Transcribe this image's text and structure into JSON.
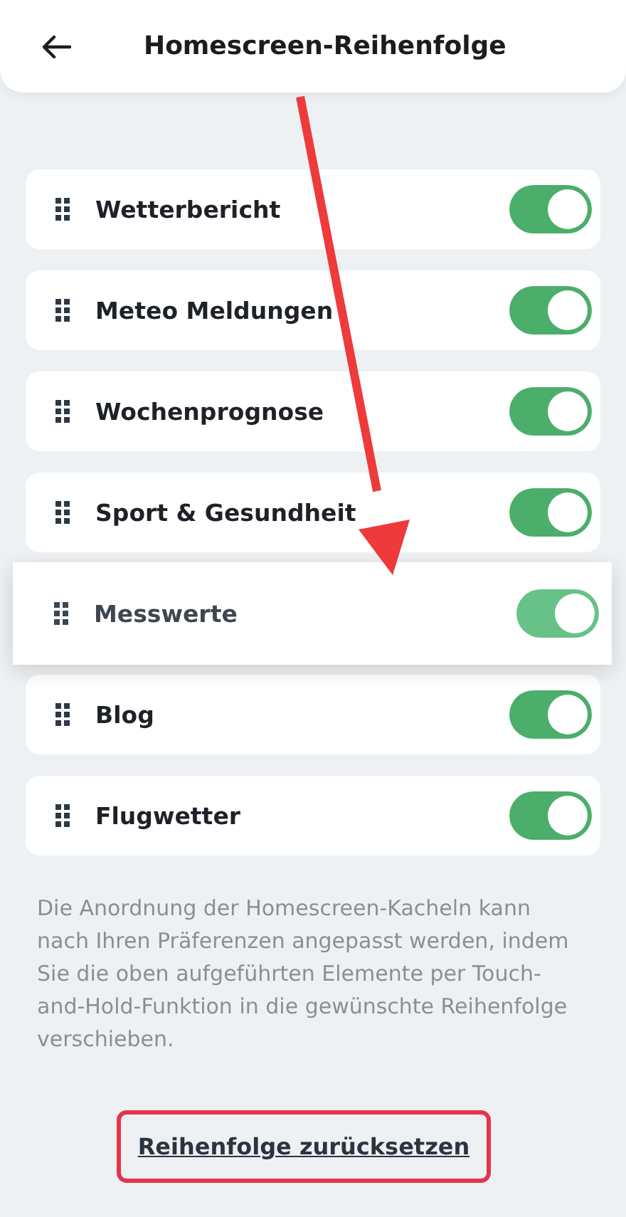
{
  "header": {
    "title": "Homescreen-Reihenfolge"
  },
  "tiles": [
    {
      "label": "Wetterbericht",
      "on": true,
      "dragging": false
    },
    {
      "label": "Meteo Meldungen",
      "on": true,
      "dragging": false
    },
    {
      "label": "Wochenprognose",
      "on": true,
      "dragging": false
    },
    {
      "label": "Sport & Gesundheit",
      "on": true,
      "dragging": false
    },
    {
      "label": "Messwerte",
      "on": true,
      "dragging": true
    },
    {
      "label": "Blog",
      "on": true,
      "dragging": false
    },
    {
      "label": "Flugwetter",
      "on": true,
      "dragging": false
    }
  ],
  "description": "Die Anordnung der Homescreen-Kacheln kann nach Ihren Präferenzen angepasst werden, indem Sie die oben aufgeführten Elemente per Touch-and-Hold-Funktion in die gewünschte Reihenfolge verschieben.",
  "reset_link": "Reihenfolge zurücksetzen"
}
